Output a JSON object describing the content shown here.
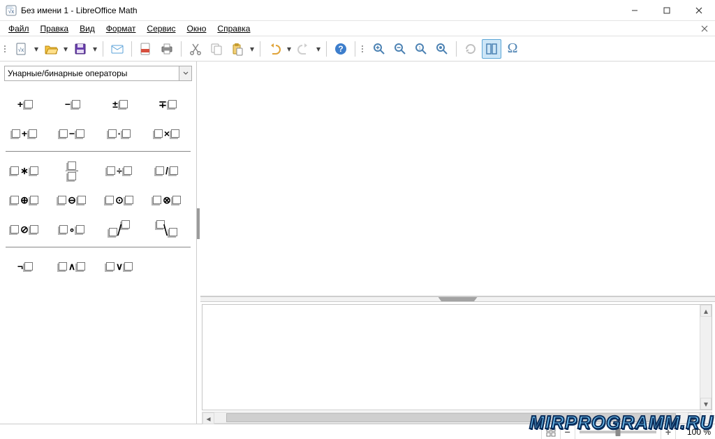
{
  "window": {
    "title": "Без имени 1 - LibreOffice Math"
  },
  "menubar": {
    "file": "Файл",
    "edit": "Правка",
    "view": "Вид",
    "format": "Формат",
    "tools": "Сервис",
    "window": "Окно",
    "help": "Справка"
  },
  "toolbar": {
    "new": "new",
    "open": "open",
    "save": "save",
    "mail": "mail",
    "export": "export",
    "print": "print",
    "cut": "cut",
    "copy": "copy",
    "paste": "paste",
    "undo": "undo",
    "redo": "redo",
    "help": "help",
    "zoom_in": "zoom-in",
    "zoom_out": "zoom-out",
    "zoom_page": "zoom-page",
    "zoom_optimal": "zoom-optimal",
    "refresh": "refresh",
    "formula_cursor": "formula-cursor",
    "symbols": "symbols"
  },
  "elements_panel": {
    "category_label": "Унарные/бинарные операторы",
    "rows": [
      {
        "sep": false,
        "items": [
          "unary-plus",
          "unary-minus",
          "plus-minus",
          "minus-plus"
        ]
      },
      {
        "sep": true,
        "items": [
          "addition",
          "subtraction",
          "multiplication-dot",
          "multiplication-cross"
        ]
      },
      {
        "sep": false,
        "items": [
          "multiplication-star",
          "division-fraction",
          "division-colon",
          "division-slash"
        ]
      },
      {
        "sep": false,
        "items": [
          "circled-plus",
          "circled-minus",
          "circled-dot",
          "circled-times"
        ]
      },
      {
        "sep": true,
        "items": [
          "circled-slash",
          "concatenate",
          "wide-slash",
          "wide-backslash"
        ]
      },
      {
        "sep": false,
        "items": [
          "boolean-not",
          "boolean-and",
          "boolean-or"
        ]
      }
    ]
  },
  "statusbar": {
    "zoom_value": "100 %"
  },
  "watermark": "MIRPROGRAMM.RU"
}
